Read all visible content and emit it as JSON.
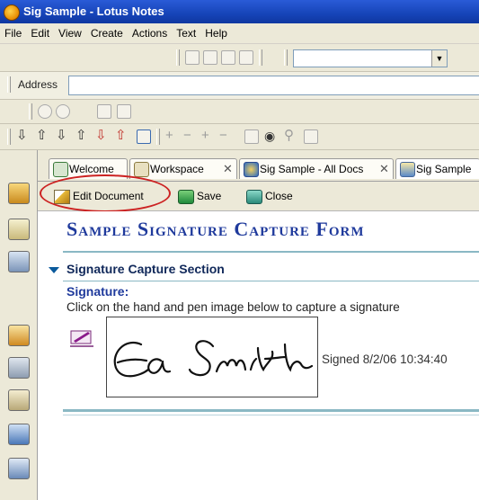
{
  "window": {
    "title": "Sig Sample - Lotus Notes"
  },
  "menu": [
    "File",
    "Edit",
    "View",
    "Create",
    "Actions",
    "Text",
    "Help"
  ],
  "address": {
    "label": "Address",
    "value": ""
  },
  "tabs": [
    {
      "label": "Welcome",
      "icon": "home-icon"
    },
    {
      "label": "Workspace",
      "icon": "workspace-icon"
    },
    {
      "label": "Sig Sample - All Docs",
      "icon": "database-globe-icon"
    },
    {
      "label": "Sig Sample",
      "icon": "document-icon"
    }
  ],
  "actions": {
    "edit": "Edit Document",
    "save": "Save",
    "close": "Close"
  },
  "document": {
    "title": "Sample Signature Capture Form",
    "section_title": "Signature Capture Section",
    "signature_label": "Signature:",
    "instructions": "Click on the hand and pen image below to capture a signature",
    "signed_text": "Signed 8/2/06 10:34:40"
  },
  "colors": {
    "title_bar": "#1644b8",
    "chrome": "#ece9d8",
    "form_title": "#1f3a9c",
    "rule": "#8ab8c4",
    "highlight_circle": "#cc2222"
  }
}
